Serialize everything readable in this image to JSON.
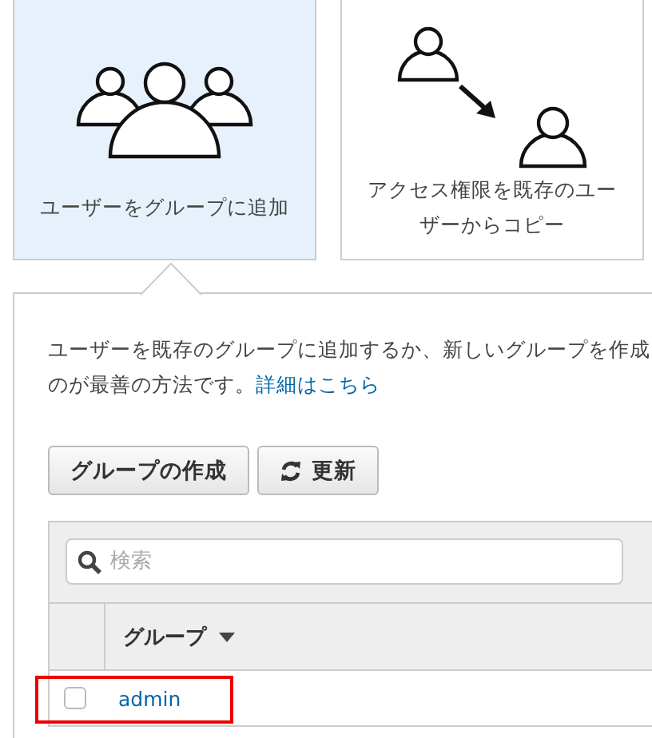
{
  "cards": [
    {
      "label": "ユーザーをグループに追加",
      "kind": "group",
      "selected": true
    },
    {
      "label": "アクセス権限を既存のユーザーからコピー",
      "kind": "copy",
      "selected": false
    }
  ],
  "description": {
    "line_1": "ユーザーを既存のグループに追加するか、新しいグループを作成",
    "line_2": "のが最善の方法です。",
    "link": "詳細はこちら"
  },
  "buttons": [
    {
      "label": "グループの作成",
      "kind": "create"
    },
    {
      "label": "更新",
      "kind": "refresh"
    }
  ],
  "search": {
    "placeholder": "検索"
  },
  "table": {
    "columns": [
      "グループ"
    ],
    "rows": [
      {
        "name": "admin",
        "checked": false,
        "highlighted": true
      }
    ]
  }
}
